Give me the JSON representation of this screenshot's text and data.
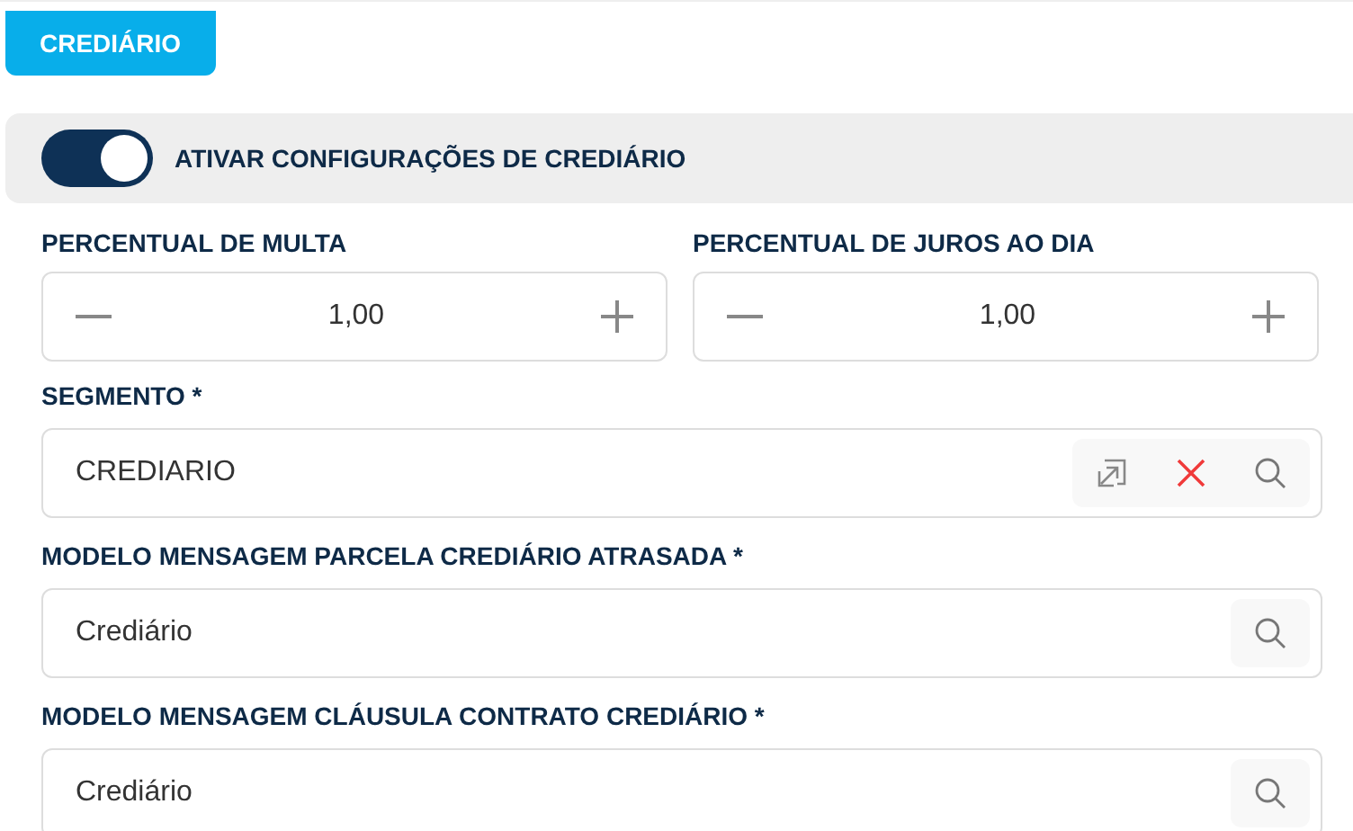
{
  "tabs": [
    {
      "label": "CREDIÁRIO",
      "selected": true
    }
  ],
  "toggle": {
    "label": "ATIVAR CONFIGURAÇÕES DE CREDIÁRIO",
    "on": true
  },
  "steppers": [
    {
      "label": "PERCENTUAL DE MULTA",
      "value": "1,00"
    },
    {
      "label": "PERCENTUAL DE JUROS AO DIA",
      "value": "1,00"
    }
  ],
  "fields": [
    {
      "label": "SEGMENTO *",
      "value": "CREDIARIO",
      "actions": [
        {
          "kind": "open"
        },
        {
          "kind": "clear"
        },
        {
          "kind": "search"
        }
      ]
    },
    {
      "label": "MODELO MENSAGEM PARCELA CREDIÁRIO ATRASADA *",
      "value": "Crediário",
      "actions": [
        {
          "kind": "search"
        }
      ]
    },
    {
      "label": "MODELO MENSAGEM CLÁUSULA CONTRATO CREDIÁRIO *",
      "value": "Crediário",
      "actions": [
        {
          "kind": "search"
        }
      ]
    }
  ]
}
